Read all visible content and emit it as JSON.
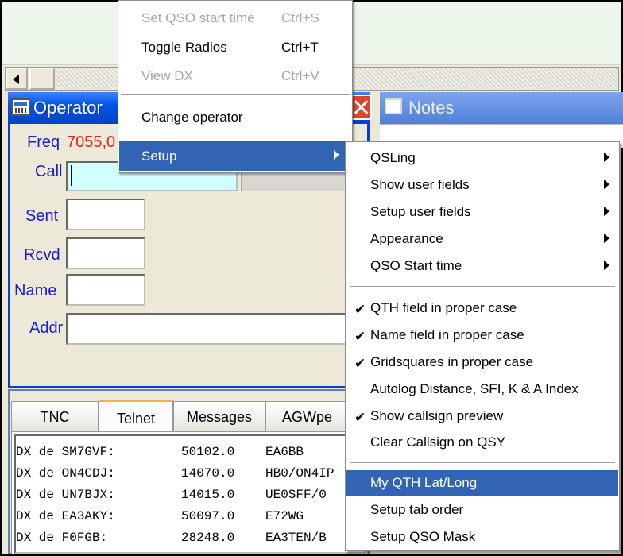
{
  "main_menu": {
    "items": [
      {
        "label": "Set QSO start time",
        "shortcut": "Ctrl+S",
        "enabled": false
      },
      {
        "label": "Toggle Radios",
        "shortcut": "Ctrl+T",
        "enabled": true
      },
      {
        "label": "View DX",
        "shortcut": "Ctrl+V",
        "enabled": false
      },
      {
        "label": "Change operator",
        "shortcut": "",
        "enabled": true
      },
      {
        "label": "Setup",
        "shortcut": "",
        "enabled": true,
        "highlighted": true
      }
    ]
  },
  "setup_menu": {
    "items": [
      {
        "label": "QSLing",
        "submenu": true
      },
      {
        "label": "Show user fields",
        "submenu": true
      },
      {
        "label": "Setup user fields",
        "submenu": true
      },
      {
        "label": "Appearance",
        "submenu": true
      },
      {
        "label": "QSO Start time",
        "submenu": true
      },
      {
        "label": "QTH field in proper case",
        "checked": true
      },
      {
        "label": "Name field in proper case",
        "checked": true
      },
      {
        "label": "Gridsquares in proper case",
        "checked": true
      },
      {
        "label": "Autolog Distance, SFI, K & A Index",
        "checked": false
      },
      {
        "label": "Show callsign preview",
        "checked": true
      },
      {
        "label": "Clear Callsign on QSY",
        "checked": false
      },
      {
        "label": "My QTH Lat/Long",
        "highlighted": true
      },
      {
        "label": "Setup tab order"
      },
      {
        "label": "Setup QSO Mask"
      }
    ],
    "check_glyph": "✔"
  },
  "operator_window": {
    "title": "Operator",
    "freq_label": "Freq",
    "freq_value": "7055,0",
    "call_label": "Call",
    "sent_label": "Sent",
    "rcvd_label": "Rcvd",
    "name_label": "Name",
    "addr_label": "Addr"
  },
  "notes_window": {
    "title": "Notes"
  },
  "lower_panel": {
    "tabs": [
      "TNC",
      "Telnet",
      "Messages",
      "AGWpe"
    ],
    "active_tab": "Telnet",
    "spots": [
      {
        "spotter": "DX de SM7GVF:",
        "freq": "50102.0",
        "dx": "EA6BB"
      },
      {
        "spotter": "DX de ON4CDJ:",
        "freq": "14070.0",
        "dx": "HB0/ON4IP"
      },
      {
        "spotter": "DX de UN7BJX:",
        "freq": "14015.0",
        "dx": "UE0SFF/0"
      },
      {
        "spotter": "DX de EA3AKY:",
        "freq": "50097.0",
        "dx": "E72WG"
      },
      {
        "spotter": "DX de F0FGB:",
        "freq": "28248.0",
        "dx": "EA3TEN/B"
      }
    ]
  },
  "colors": {
    "menu_highlight": "#3264b4",
    "title_bar": "#0554e3",
    "field_label": "#1a1ad0",
    "freq_value": "#e22222",
    "call_field_bg": "#cfffff"
  }
}
